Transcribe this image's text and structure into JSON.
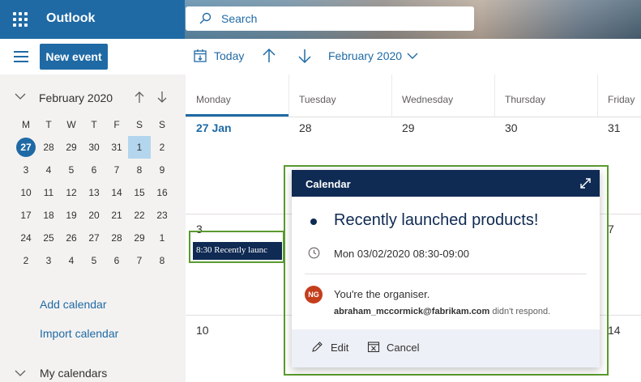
{
  "header": {
    "app_name": "Outlook",
    "search_placeholder": "Search"
  },
  "toolbar": {
    "new_event_label": "New event",
    "today_label": "Today",
    "month_label": "February 2020"
  },
  "mini_calendar": {
    "title": "February 2020",
    "weekdays": [
      "M",
      "T",
      "W",
      "T",
      "F",
      "S",
      "S"
    ],
    "weeks": [
      [
        "27",
        "28",
        "29",
        "30",
        "31",
        "1",
        "2"
      ],
      [
        "3",
        "4",
        "5",
        "6",
        "7",
        "8",
        "9"
      ],
      [
        "10",
        "11",
        "12",
        "13",
        "14",
        "15",
        "16"
      ],
      [
        "17",
        "18",
        "19",
        "20",
        "21",
        "22",
        "23"
      ],
      [
        "24",
        "25",
        "26",
        "27",
        "28",
        "29",
        "1"
      ],
      [
        "2",
        "3",
        "4",
        "5",
        "6",
        "7",
        "8"
      ]
    ],
    "today_day": "27",
    "selected_day": "1"
  },
  "left_nav": {
    "add_calendar": "Add calendar",
    "import_calendar": "Import calendar",
    "my_calendars": "My calendars"
  },
  "calendar": {
    "day_headers": [
      "Monday",
      "Tuesday",
      "Wednesday",
      "Thursday",
      "Friday"
    ],
    "week1": [
      "27 Jan",
      "28",
      "29",
      "30",
      "31"
    ],
    "week2": [
      "3",
      "7"
    ],
    "week3": [
      "10",
      "14"
    ],
    "event_chip": "8:30 Recently launc"
  },
  "popup": {
    "header_title": "Calendar",
    "event_title": "Recently launched products!",
    "event_time": "Mon 03/02/2020 08:30-09:00",
    "avatar_initials": "NG",
    "organiser_text": "You're the organiser.",
    "attendee_email": "abraham_mccormick@fabrikam.com",
    "attendee_status": "didn't respond.",
    "edit_label": "Edit",
    "cancel_label": "Cancel"
  },
  "colors": {
    "brand_blue": "#1f6aa5",
    "navy": "#0f2a53",
    "highlight_green": "#5a9a2f",
    "avatar": "#c43e1c"
  }
}
